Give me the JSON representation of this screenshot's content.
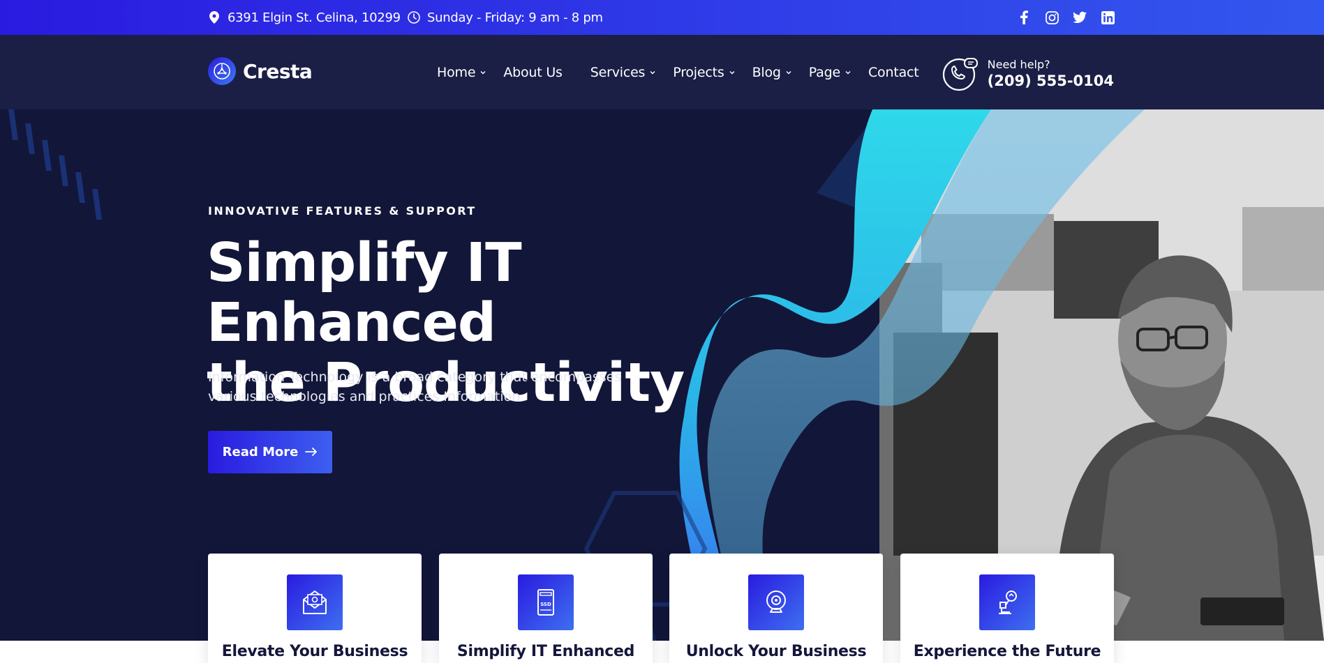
{
  "topbar": {
    "address": "6391 Elgin St. Celina, 10299",
    "hours": "Sunday - Friday: 9 am - 8 pm",
    "social": [
      "facebook-icon",
      "instagram-icon",
      "twitter-icon",
      "linkedin-icon"
    ]
  },
  "header": {
    "brand": "Cresta",
    "nav": [
      {
        "label": "Home",
        "dropdown": true
      },
      {
        "label": "About Us",
        "dropdown": false
      },
      {
        "label": "Services",
        "dropdown": true
      },
      {
        "label": "Projects",
        "dropdown": true
      },
      {
        "label": "Blog",
        "dropdown": true
      },
      {
        "label": "Page",
        "dropdown": true
      },
      {
        "label": "Contact",
        "dropdown": false
      }
    ],
    "help_label": "Need help?",
    "help_phone": "(209) 555-0104"
  },
  "hero": {
    "tagline": "INNOVATIVE FEATURES & SUPPORT",
    "title_line1": "Simplify IT Enhanced",
    "title_line2": "the Productivity",
    "description_line1": "Information Technology is a broad category that encompasses",
    "description_line2": "various technologies and practices Information",
    "button_label": "Read More"
  },
  "cards": [
    {
      "title": "Elevate Your Business",
      "icon": "email-icon"
    },
    {
      "title": "Simplify IT Enhanced",
      "icon": "ssd-icon"
    },
    {
      "title": "Unlock Your Business",
      "icon": "webcam-icon"
    },
    {
      "title": "Experience the Future",
      "icon": "robot-arm-icon"
    }
  ],
  "colors": {
    "accent": "#2a1be0",
    "accent_light": "#3d7bf0",
    "hero_bg": "#121638",
    "header_bg": "#1b1f45",
    "cyan": "#2fd0e8"
  }
}
